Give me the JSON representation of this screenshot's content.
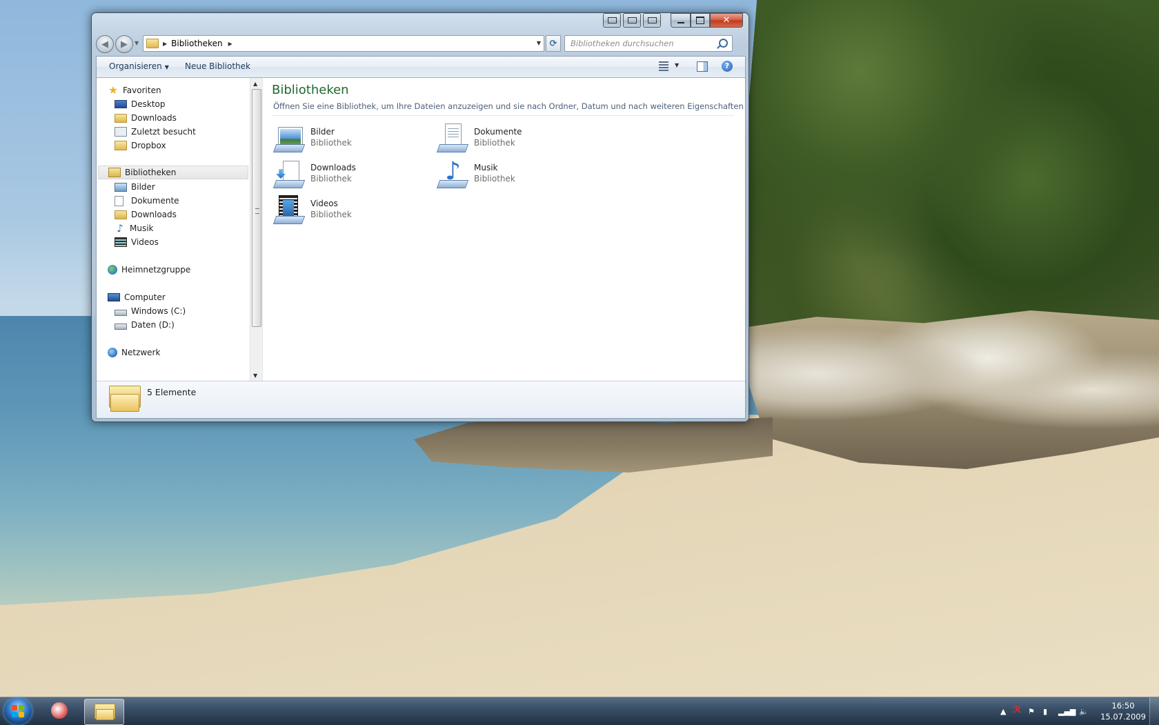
{
  "desktop": {
    "wallpaper": "beach-with-rocks-and-forest"
  },
  "window": {
    "caption_buttons": [
      "extra-1",
      "extra-2",
      "extra-3",
      "minimize",
      "maximize",
      "close"
    ],
    "close_glyph": "✕",
    "address": {
      "segments": [
        "Bibliotheken"
      ]
    },
    "search": {
      "placeholder": "Bibliotheken durchsuchen"
    },
    "toolbar": {
      "organize_label": "Organisieren",
      "new_library_label": "Neue Bibliothek"
    },
    "nav": {
      "favorites": {
        "label": "Favoriten",
        "items": [
          {
            "label": "Desktop",
            "icon": "desktop-icon"
          },
          {
            "label": "Downloads",
            "icon": "downloads-folder-icon"
          },
          {
            "label": "Zuletzt besucht",
            "icon": "recent-places-icon"
          },
          {
            "label": "Dropbox",
            "icon": "dropbox-folder-icon"
          }
        ]
      },
      "libraries": {
        "label": "Bibliotheken",
        "items": [
          {
            "label": "Bilder",
            "icon": "pictures-library-icon"
          },
          {
            "label": "Dokumente",
            "icon": "documents-library-icon"
          },
          {
            "label": "Downloads",
            "icon": "downloads-library-icon"
          },
          {
            "label": "Musik",
            "icon": "music-library-icon"
          },
          {
            "label": "Videos",
            "icon": "videos-library-icon"
          }
        ]
      },
      "homegroup": {
        "label": "Heimnetzgruppe"
      },
      "computer": {
        "label": "Computer",
        "items": [
          {
            "label": "Windows (C:)",
            "icon": "windows-drive-icon"
          },
          {
            "label": "Daten (D:)",
            "icon": "data-drive-icon"
          }
        ]
      },
      "network": {
        "label": "Netzwerk"
      }
    },
    "content": {
      "title": "Bibliotheken",
      "description": "Öffnen Sie eine Bibliothek, um Ihre Dateien anzuzeigen und sie nach Ordner, Datum und nach weiteren Eigenschaften anz...",
      "libraries": [
        {
          "name": "Bilder",
          "type": "Bibliothek",
          "icon": "pictures-library-icon"
        },
        {
          "name": "Dokumente",
          "type": "Bibliothek",
          "icon": "documents-library-icon"
        },
        {
          "name": "Downloads",
          "type": "Bibliothek",
          "icon": "downloads-library-icon"
        },
        {
          "name": "Musik",
          "type": "Bibliothek",
          "icon": "music-library-icon"
        },
        {
          "name": "Videos",
          "type": "Bibliothek",
          "icon": "videos-library-icon"
        }
      ]
    },
    "details": {
      "count_text": "5 Elemente"
    }
  },
  "taskbar": {
    "apps": [
      {
        "name": "pinned-app",
        "icon": "app-icon"
      },
      {
        "name": "windows-explorer",
        "icon": "explorer-folder-icon",
        "active": true
      }
    ],
    "tray_icons": [
      "show-hidden-icons-arrow",
      "antivirus-icon",
      "action-center-flag-icon",
      "power-icon",
      "network-signal-icon",
      "volume-icon"
    ],
    "clock": {
      "time": "16:50",
      "date": "15.07.2009"
    }
  },
  "colors": {
    "title_green": "#1e6a2e",
    "toolbar_text": "#1e395b",
    "close_red": "#c1371c",
    "taskbar": "#31465e"
  }
}
